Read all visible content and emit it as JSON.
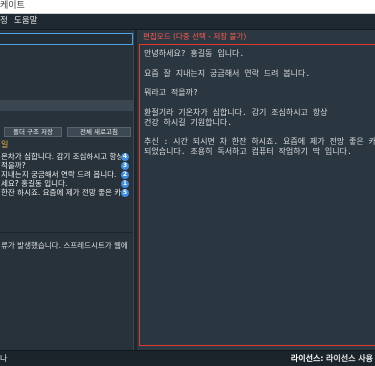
{
  "window": {
    "title": "케이트"
  },
  "menu": {
    "items": [
      {
        "label": "정"
      },
      {
        "label": "도움말"
      }
    ]
  },
  "left": {
    "search": {
      "value": ""
    },
    "buttons": {
      "save_folder": "폴더 구조 저장",
      "refresh_all": "전체 새로고침"
    },
    "section_label": "일",
    "list": [
      {
        "text": "온차가 심합니다. 감기 조심하시고 항상",
        "badge": "4"
      },
      {
        "text": "적을까?",
        "badge": "3"
      },
      {
        "text": "지내는지 궁금해서 연락 드려 봅니다.",
        "badge": "2"
      },
      {
        "text": "세요? 홍길동 입니다.",
        "badge": "1"
      },
      {
        "text": "한잔 하시죠. 요즘에 제가 전망 좋은 카",
        "badge": "5"
      }
    ],
    "log_message": "류가 발생했습니다. 스프레드시트가 웹에"
  },
  "editor": {
    "mode_label": "편집모드 (다중 선택 - 저장 불가)",
    "lines": [
      "안녕하세요? 홍길동 입니다.",
      "",
      "요즘 잘 지내는지 궁금해서 연락 드려 봅니다.",
      "",
      "뭐라고 적을까?",
      "",
      "환절기라 기온차가 심합니다. 감기 조심하시고 항상",
      "건강 하시길 기원합니다.",
      "",
      "추신 : 시간 되시면 차 한잔 하시죠. 요즘에 제가 전망 좋은 카",
      "되었습니다. 조용히 독서하고 컴퓨터 작업하기 딱 입니다."
    ]
  },
  "status": {
    "left_text": "나",
    "license_label": "라이선스:",
    "license_value": "라이선스 사용"
  },
  "colors": {
    "editor_border": "#e0392e",
    "mode_label": "#ff5b4f",
    "focus_blue": "#4f9fe8",
    "badge_blue": "#3d8ee0",
    "section_orange": "#f0b43c"
  }
}
